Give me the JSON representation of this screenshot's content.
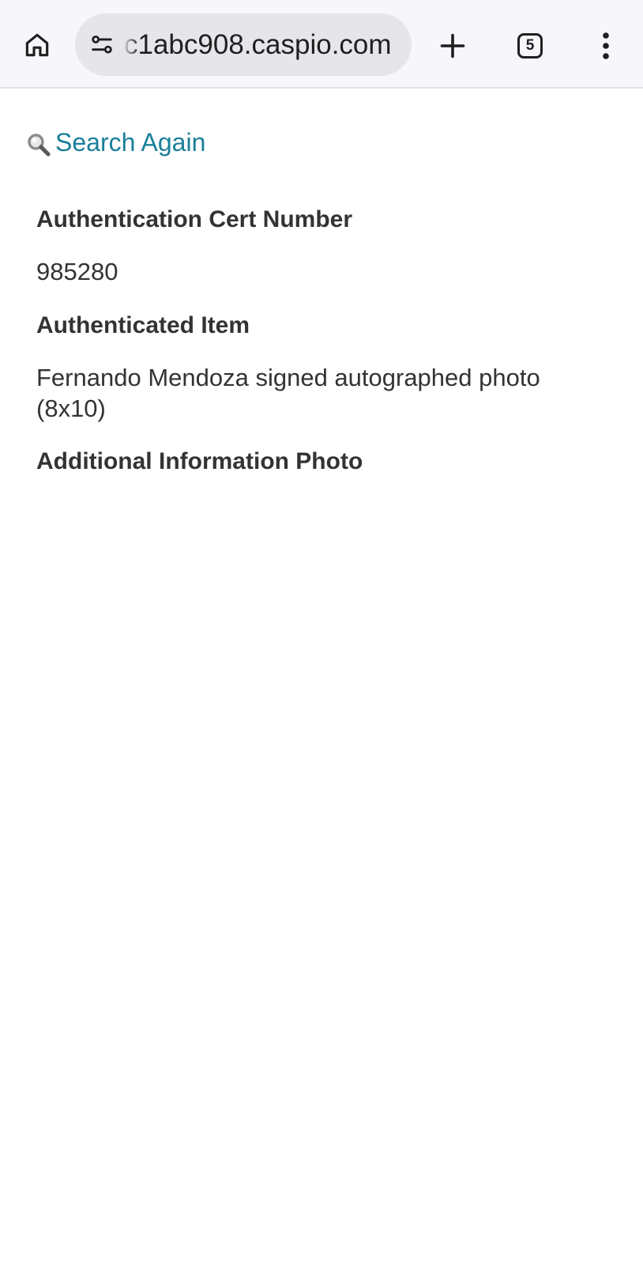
{
  "browser": {
    "url": "c1abc908.caspio.com",
    "tab_count": "5"
  },
  "page": {
    "search_again_label": "Search Again",
    "fields": [
      {
        "label": "Authentication Cert Number",
        "value": "985280"
      },
      {
        "label": "Authenticated Item",
        "value": "Fernando Mendoza signed autographed photo (8x10)"
      },
      {
        "label": "Additional Information Photo",
        "value": ""
      }
    ]
  },
  "colors": {
    "link": "#1a7f99",
    "text": "#333333",
    "toolbar_bg": "#f7f6fb",
    "url_bar_bg": "#e6e5ea"
  },
  "icons": [
    "home-icon",
    "site-info-icon",
    "plus-icon",
    "tab-switcher-icon",
    "more-vert-icon",
    "magnifier-icon"
  ]
}
